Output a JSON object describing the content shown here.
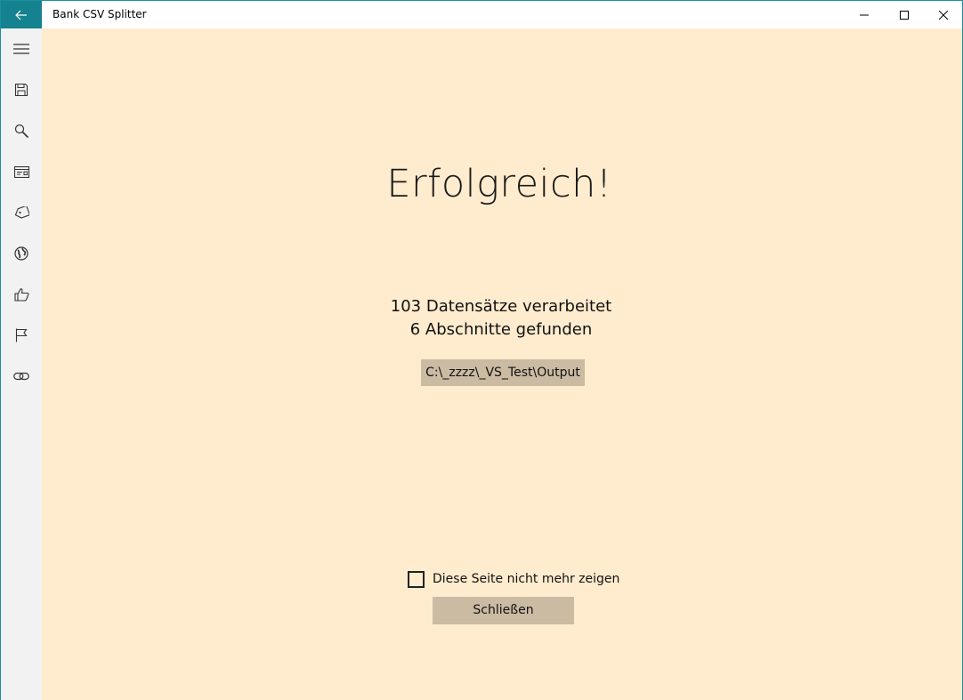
{
  "window": {
    "title": "Bank CSV Splitter",
    "accent_color": "#14828f",
    "content_background": "#ffecce"
  },
  "titlebar": {
    "back_icon": "arrow-left-icon",
    "controls": [
      "minimize-icon",
      "maximize-icon",
      "close-icon"
    ]
  },
  "sidebar": {
    "items": [
      {
        "icon": "hamburger-menu-icon"
      },
      {
        "icon": "save-icon"
      },
      {
        "icon": "search-icon"
      },
      {
        "icon": "card-icon"
      },
      {
        "icon": "tag-icon"
      },
      {
        "icon": "globe-icon"
      },
      {
        "icon": "thumbs-up-icon"
      },
      {
        "icon": "flag-icon"
      },
      {
        "icon": "link-icon"
      }
    ]
  },
  "main": {
    "heading": "Erfolgreich!",
    "records_text": "103 Datensätze verarbeitet",
    "sections_text": "6 Abschnitte gefunden",
    "output_path": "C:\\_zzzz\\_VS_Test\\Output",
    "dont_show_label": "Diese Seite nicht mehr zeigen",
    "dont_show_checked": false,
    "close_label": "Schließen",
    "button_color": "#ccbba3"
  }
}
